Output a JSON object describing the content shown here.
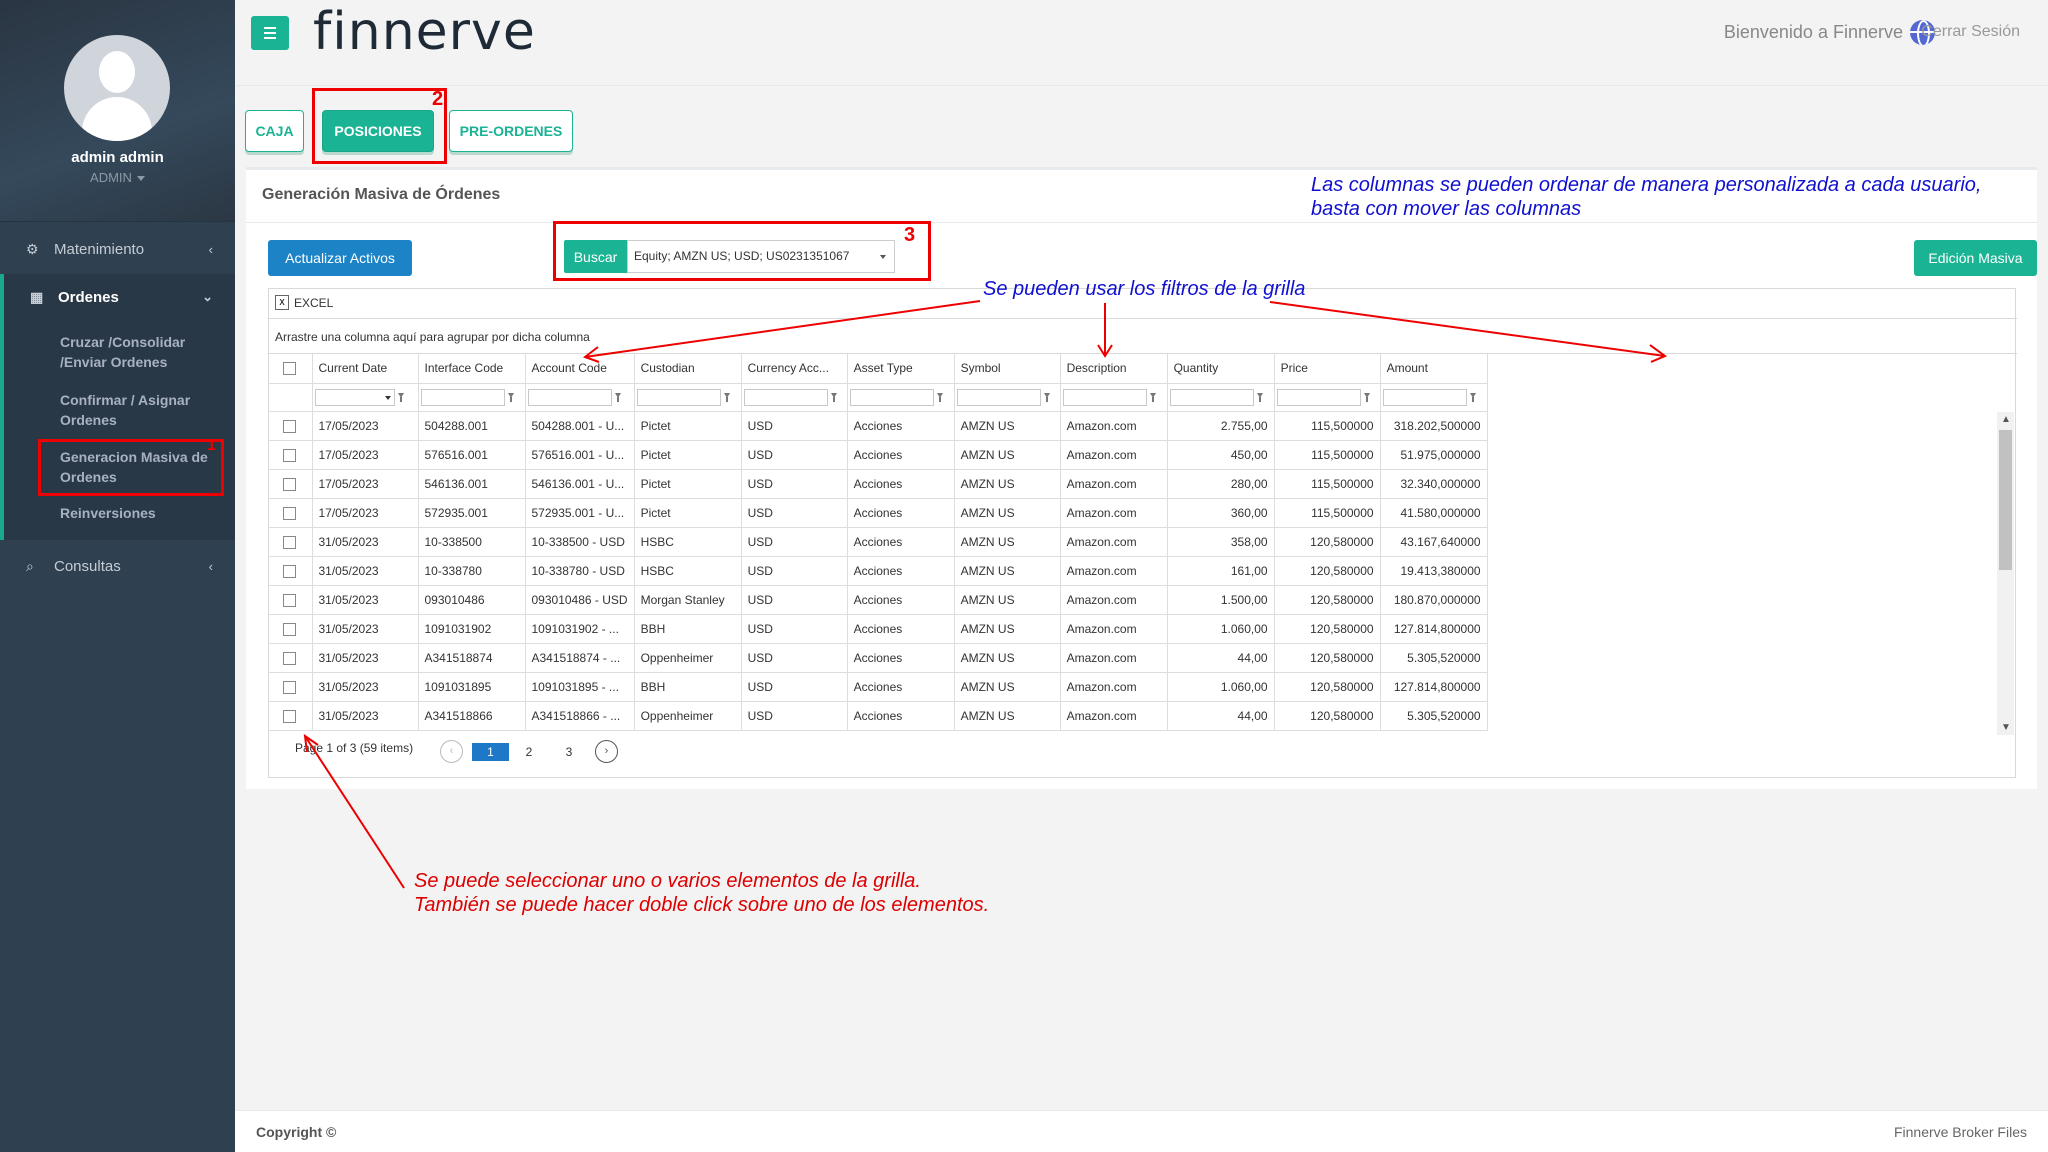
{
  "app": {
    "brand": "finnerve"
  },
  "header": {
    "welcome": "Bienvenido a Finnerve",
    "logout": "Cerrar Sesión"
  },
  "sidebar": {
    "user_name": "admin admin",
    "user_role": "ADMIN",
    "items": [
      {
        "label": "Matenimiento",
        "icon": "gears-icon"
      },
      {
        "label": "Ordenes",
        "icon": "grid-icon"
      },
      {
        "label": "Consultas",
        "icon": "search-icon"
      }
    ],
    "submenu": [
      "Cruzar /Consolidar /Enviar Ordenes",
      "Confirmar / Asignar Ordenes",
      "Generacion Masiva de Ordenes",
      "Reinversiones"
    ]
  },
  "tabs": [
    "CAJA",
    "POSICIONES",
    "PRE-ORDENES"
  ],
  "card": {
    "title": "Generación Masiva de Órdenes",
    "update_button": "Actualizar Activos",
    "search_button": "Buscar",
    "search_value": "Equity; AMZN US; USD; US0231351067",
    "bulk_button": "Edición Masiva"
  },
  "grid": {
    "excel_label": "EXCEL",
    "group_hint": "Arrastre una columna aquí para agrupar por dicha columna",
    "columns": [
      "Current Date",
      "Interface Code",
      "Account Code",
      "Custodian",
      "Currency Acc...",
      "Asset Type",
      "Symbol",
      "Description",
      "Quantity",
      "Price",
      "Amount"
    ],
    "rows": [
      [
        "17/05/2023",
        "504288.001",
        "504288.001 - U...",
        "Pictet",
        "USD",
        "Acciones",
        "AMZN US",
        "Amazon.com",
        "2.755,00",
        "115,500000",
        "318.202,500000"
      ],
      [
        "17/05/2023",
        "576516.001",
        "576516.001 - U...",
        "Pictet",
        "USD",
        "Acciones",
        "AMZN US",
        "Amazon.com",
        "450,00",
        "115,500000",
        "51.975,000000"
      ],
      [
        "17/05/2023",
        "546136.001",
        "546136.001 - U...",
        "Pictet",
        "USD",
        "Acciones",
        "AMZN US",
        "Amazon.com",
        "280,00",
        "115,500000",
        "32.340,000000"
      ],
      [
        "17/05/2023",
        "572935.001",
        "572935.001 - U...",
        "Pictet",
        "USD",
        "Acciones",
        "AMZN US",
        "Amazon.com",
        "360,00",
        "115,500000",
        "41.580,000000"
      ],
      [
        "31/05/2023",
        "10-338500",
        "10-338500 - USD",
        "HSBC",
        "USD",
        "Acciones",
        "AMZN US",
        "Amazon.com",
        "358,00",
        "120,580000",
        "43.167,640000"
      ],
      [
        "31/05/2023",
        "10-338780",
        "10-338780 - USD",
        "HSBC",
        "USD",
        "Acciones",
        "AMZN US",
        "Amazon.com",
        "161,00",
        "120,580000",
        "19.413,380000"
      ],
      [
        "31/05/2023",
        "093010486",
        "093010486 - USD",
        "Morgan Stanley",
        "USD",
        "Acciones",
        "AMZN US",
        "Amazon.com",
        "1.500,00",
        "120,580000",
        "180.870,000000"
      ],
      [
        "31/05/2023",
        "1091031902",
        "1091031902 - ...",
        "BBH",
        "USD",
        "Acciones",
        "AMZN US",
        "Amazon.com",
        "1.060,00",
        "120,580000",
        "127.814,800000"
      ],
      [
        "31/05/2023",
        "A341518874",
        "A341518874 - ...",
        "Oppenheimer",
        "USD",
        "Acciones",
        "AMZN US",
        "Amazon.com",
        "44,00",
        "120,580000",
        "5.305,520000"
      ],
      [
        "31/05/2023",
        "1091031895",
        "1091031895 - ...",
        "BBH",
        "USD",
        "Acciones",
        "AMZN US",
        "Amazon.com",
        "1.060,00",
        "120,580000",
        "127.814,800000"
      ],
      [
        "31/05/2023",
        "A341518866",
        "A341518866 - ...",
        "Oppenheimer",
        "USD",
        "Acciones",
        "AMZN US",
        "Amazon.com",
        "44,00",
        "120,580000",
        "5.305,520000"
      ]
    ],
    "pager_text": "Page 1 of 3 (59 items)",
    "pages": [
      "1",
      "2",
      "3"
    ],
    "current_page": "1"
  },
  "footer": {
    "copyright": "Copyright ©",
    "right": "Finnerve Broker Files"
  },
  "annotations": {
    "num1": "1",
    "num2": "2",
    "num3": "3",
    "columns_note_line1": "Las columnas se pueden ordenar de manera personalizada a cada usuario,",
    "columns_note_line2": "basta con mover las columnas",
    "filters_note": "Se pueden usar los filtros de la grilla",
    "select_note_line1": "Se puede seleccionar uno o varios elementos de la grilla.",
    "select_note_line2": "También se puede hacer doble click sobre uno de los elementos."
  },
  "colors": {
    "accent": "#1ab394",
    "primary": "#1c84c6",
    "sidebar": "#2f4050",
    "annotation_red": "#ee0000",
    "annotation_blue": "#1010d0"
  }
}
